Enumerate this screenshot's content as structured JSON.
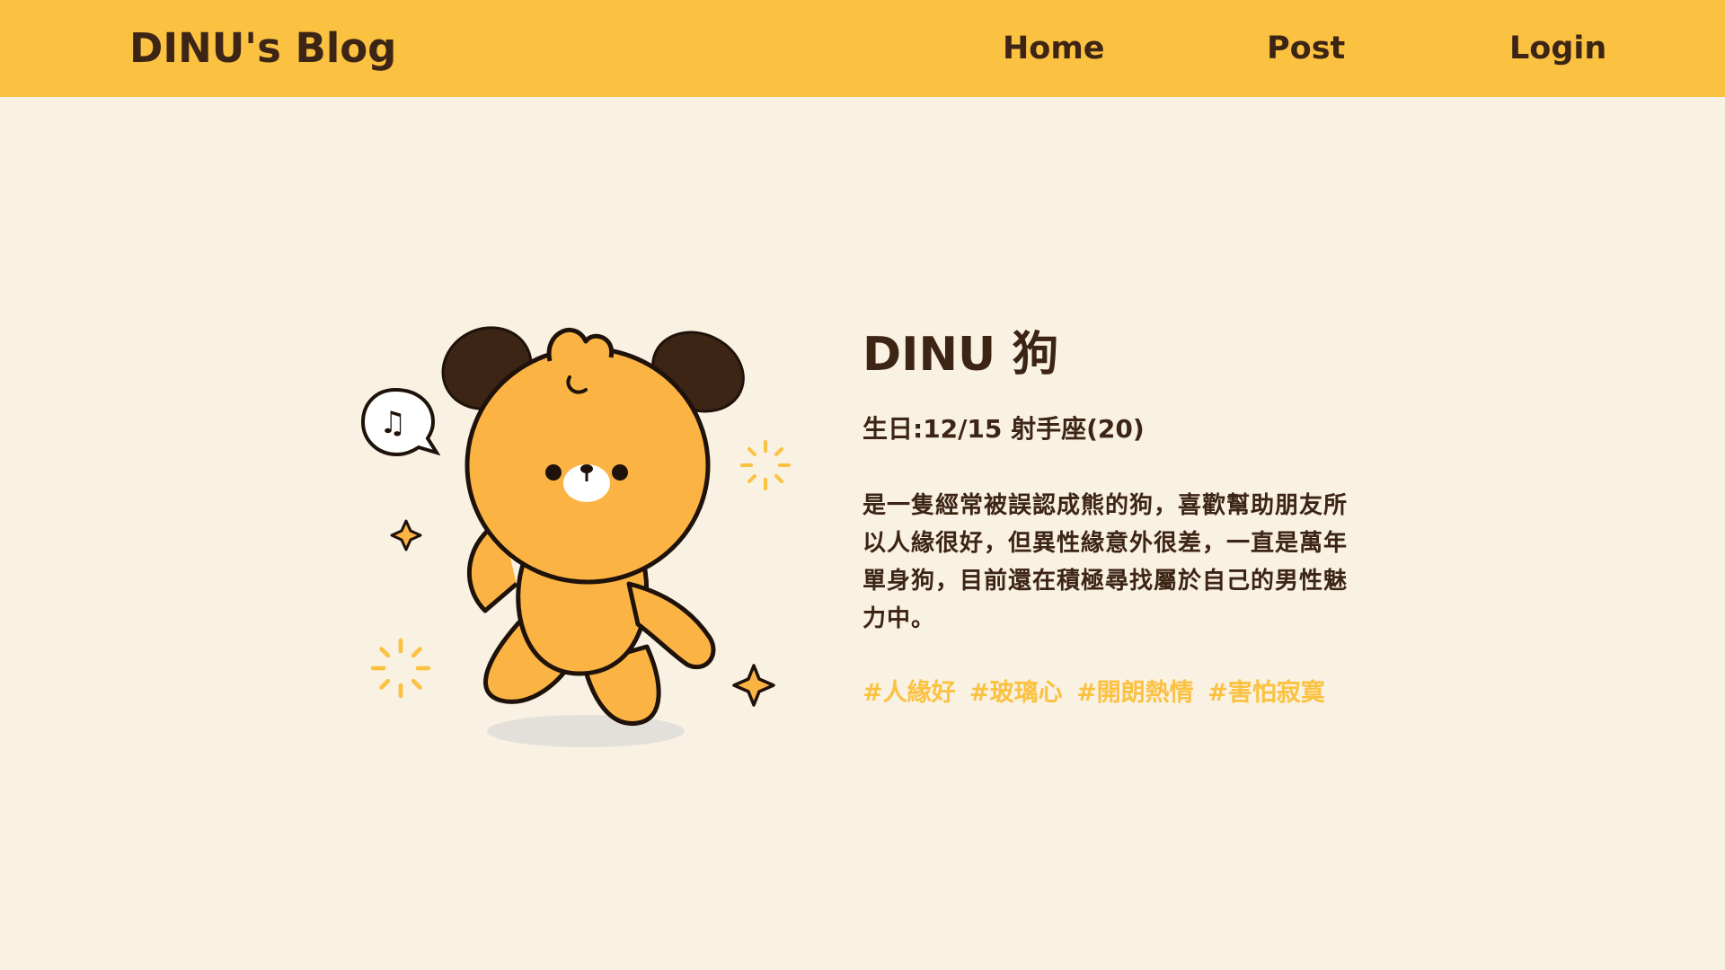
{
  "navbar": {
    "brand": "DINU's Blog",
    "links": [
      "Home",
      "Post",
      "Login"
    ]
  },
  "profile": {
    "name": "DINU 狗",
    "birthday": "生日:12/15 射手座(20)",
    "description": "是一隻經常被誤認成熊的狗，喜歡幫助朋友所以人緣很好，但異性緣意外很差，一直是萬年單身狗，目前還在積極尋找屬於自己的男性魅力中。",
    "tags": [
      "#人緣好",
      "#玻璃心",
      "#開朗熱情",
      "#害怕寂寞"
    ]
  },
  "colors": {
    "header_bg": "#fbc141",
    "page_bg": "#f9f1e1",
    "text": "#3d2516",
    "tag": "#fbc141"
  },
  "icons": [
    "music-note-icon",
    "sparkle-icon",
    "burst-icon"
  ]
}
